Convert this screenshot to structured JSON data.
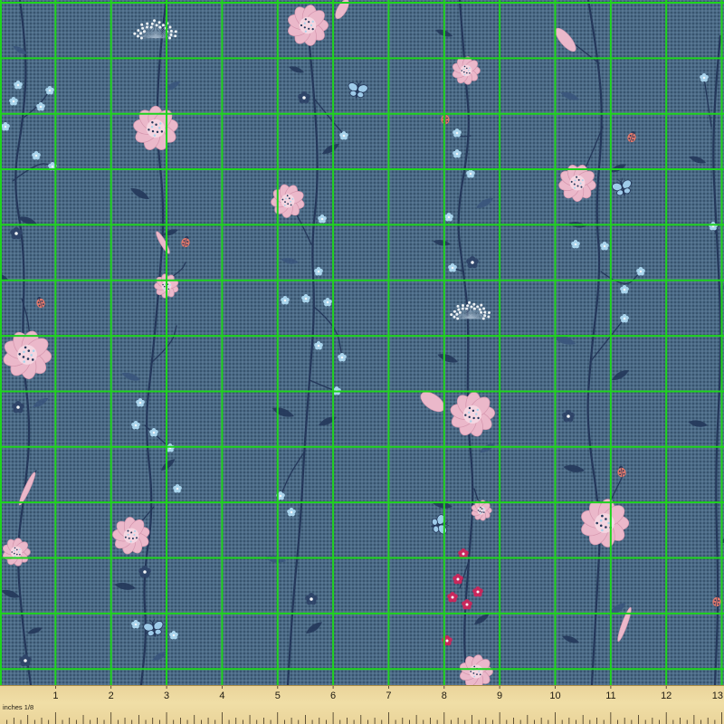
{
  "swatch": {
    "colors": {
      "fabric": "#4b6a86",
      "grid": "#1fd41d",
      "stem": "#24375a",
      "leaf": "#3a557c",
      "petal": "#ebb8ca",
      "petal_edge": "#d495ad",
      "blossom_blue": "#a9d4ec",
      "blossom_dark": "#2f4569",
      "berry": "#c8285c",
      "butterfly": "#9ecbe9",
      "ladybug": "#e2786b",
      "ruler": "#ead49a"
    }
  },
  "ruler": {
    "label": "inches 1/8",
    "numbers": [
      "1",
      "2",
      "3",
      "4",
      "5",
      "6",
      "7",
      "8",
      "9",
      "10",
      "11",
      "12",
      "13"
    ]
  }
}
